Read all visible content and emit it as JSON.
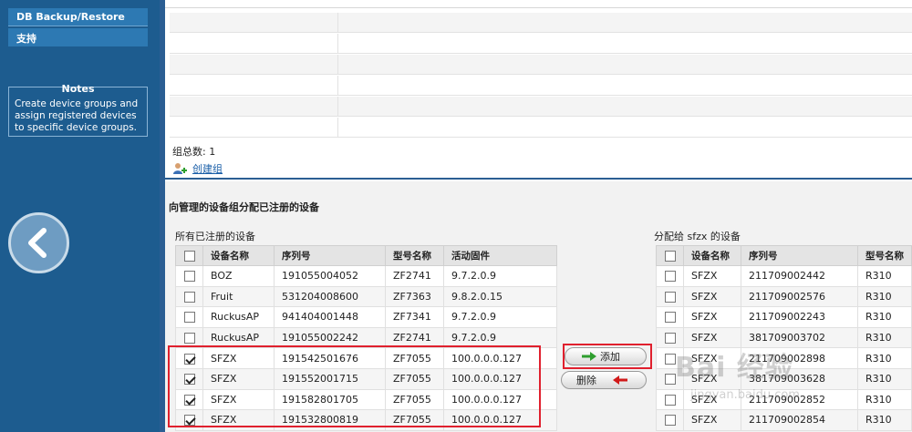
{
  "sidebar": {
    "items": [
      {
        "label": "DB Backup/Restore"
      },
      {
        "label": "支持"
      }
    ],
    "notes": {
      "title": "Notes",
      "text": "Create device groups and assign registered devices to specific device groups."
    },
    "back_icon": "chevron-left-icon"
  },
  "groups": {
    "count_text": "组总数: 1",
    "create_label": "创建组",
    "create_icon": "add-group-icon"
  },
  "assign": {
    "title": "向管理的设备组分配已注册的设备",
    "left_caption": "所有已注册的设备",
    "right_caption": "分配给 sfzx 的设备",
    "left_columns": [
      "设备名称",
      "序列号",
      "型号名称",
      "活动固件"
    ],
    "left_rows": [
      {
        "checked": false,
        "name": "BOZ",
        "serial": "191055004052",
        "model": "ZF2741",
        "firmware": "9.7.2.0.9"
      },
      {
        "checked": false,
        "name": "Fruit",
        "serial": "531204008600",
        "model": "ZF7363",
        "firmware": "9.8.2.0.15"
      },
      {
        "checked": false,
        "name": "RuckusAP",
        "serial": "941404001448",
        "model": "ZF7341",
        "firmware": "9.7.2.0.9"
      },
      {
        "checked": false,
        "name": "RuckusAP",
        "serial": "191055002242",
        "model": "ZF2741",
        "firmware": "9.7.2.0.9"
      },
      {
        "checked": true,
        "name": "SFZX",
        "serial": "191542501676",
        "model": "ZF7055",
        "firmware": "100.0.0.0.127"
      },
      {
        "checked": true,
        "name": "SFZX",
        "serial": "191552001715",
        "model": "ZF7055",
        "firmware": "100.0.0.0.127"
      },
      {
        "checked": true,
        "name": "SFZX",
        "serial": "191582801705",
        "model": "ZF7055",
        "firmware": "100.0.0.0.127"
      },
      {
        "checked": true,
        "name": "SFZX",
        "serial": "191532800819",
        "model": "ZF7055",
        "firmware": "100.0.0.0.127"
      }
    ],
    "right_columns": [
      "设备名称",
      "序列号",
      "型号名称"
    ],
    "right_rows": [
      {
        "checked": false,
        "name": "SFZX",
        "serial": "211709002442",
        "model": "R310"
      },
      {
        "checked": false,
        "name": "SFZX",
        "serial": "211709002576",
        "model": "R310"
      },
      {
        "checked": false,
        "name": "SFZX",
        "serial": "211709002243",
        "model": "R310"
      },
      {
        "checked": false,
        "name": "SFZX",
        "serial": "381709003702",
        "model": "R310"
      },
      {
        "checked": false,
        "name": "SFZX",
        "serial": "211709002898",
        "model": "R310"
      },
      {
        "checked": false,
        "name": "SFZX",
        "serial": "381709003628",
        "model": "R310"
      },
      {
        "checked": false,
        "name": "SFZX",
        "serial": "211709002852",
        "model": "R310"
      },
      {
        "checked": false,
        "name": "SFZX",
        "serial": "211709002854",
        "model": "R310"
      }
    ],
    "add_label": "添加",
    "delete_label": "删除",
    "colors": {
      "add_arrow": "#2e9e2e",
      "delete_arrow": "#d11a1a",
      "highlight": "#e0202e"
    }
  },
  "watermark": {
    "text": "Bai 经验",
    "sub": "jingyan.baidu.com"
  }
}
